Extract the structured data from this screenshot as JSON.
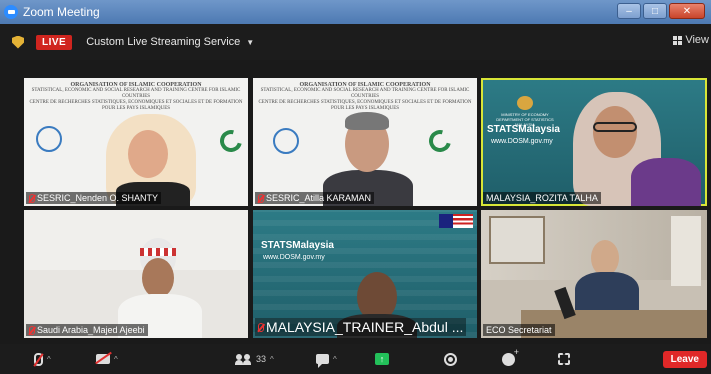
{
  "window": {
    "title": "Zoom Meeting"
  },
  "topbar": {
    "live_label": "LIVE",
    "stream_label": "Custom Live Streaming Service",
    "view_label": "View"
  },
  "oic_header": {
    "line1": "ORGANISATION OF ISLAMIC COOPERATION",
    "line2": "STATISTICAL, ECONOMIC AND SOCIAL RESEARCH AND TRAINING CENTRE FOR ISLAMIC COUNTRIES",
    "line3": "CENTRE DE RECHERCHES STATISTIQUES, ECONOMIQUES ET SOCIALES ET DE FORMATION POUR LES PAYS ISLAMIQUES"
  },
  "stats_logo": {
    "ministry": "MINISTRY OF ECONOMY",
    "dept": "DEPARTMENT OF STATISTICS MALAYSIA",
    "brand": "STATSMalaysia",
    "url": "www.DOSM.gov.my"
  },
  "participants": [
    {
      "name": "SESRIC_Nenden O. SHANTY",
      "muted": true
    },
    {
      "name": "SESRIC_Atilla KARAMAN",
      "muted": true
    },
    {
      "name": "MALAYSIA_ROZITA TALHA",
      "muted": false,
      "speaking": true
    },
    {
      "name": "Saudi Arabia_Majed Ajeebi",
      "muted": true
    },
    {
      "name": "MALAYSIA_TRAINER_Abdul ...",
      "muted": true
    },
    {
      "name": "ECO Secretariat",
      "muted": false
    }
  ],
  "toolbar": {
    "participants_count": "33",
    "leave_label": "Leave"
  },
  "colors": {
    "live": "#d0251f",
    "active_speaker": "#d8e637",
    "leave": "#e02828",
    "share": "#23c05a"
  }
}
